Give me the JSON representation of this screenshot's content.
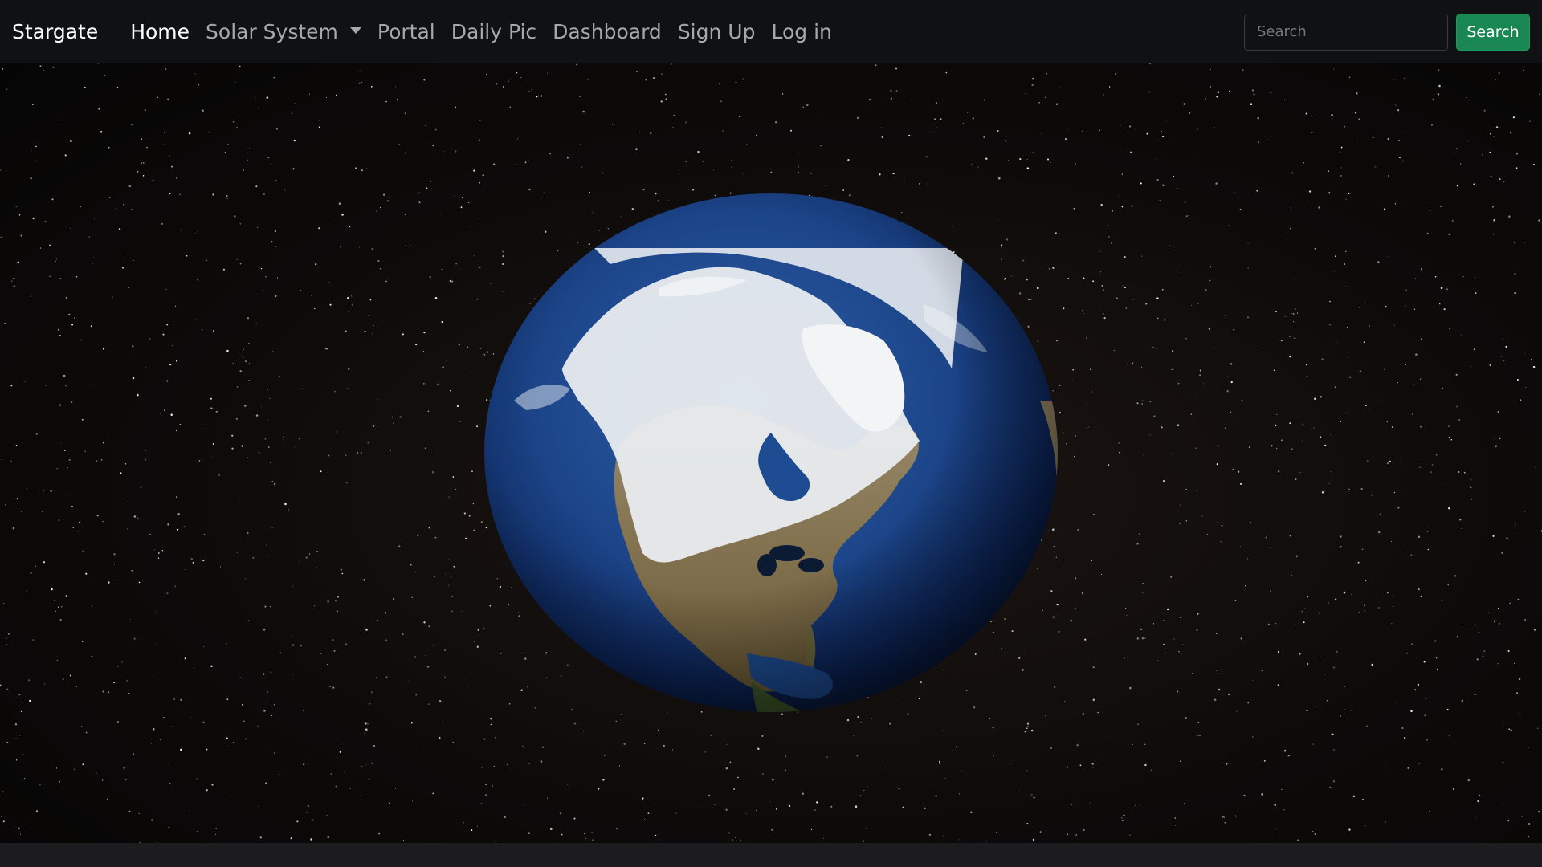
{
  "navbar": {
    "brand": "Stargate",
    "links": [
      {
        "label": "Home",
        "active": true
      },
      {
        "label": "Solar System",
        "dropdown": true
      },
      {
        "label": "Portal"
      },
      {
        "label": "Daily Pic"
      },
      {
        "label": "Dashboard"
      },
      {
        "label": "Sign Up"
      },
      {
        "label": "Log in"
      }
    ],
    "search": {
      "placeholder": "Search",
      "value": "",
      "button_label": "Search"
    }
  },
  "scene": {
    "subject": "earth-globe",
    "icons": {
      "dropdown": "caret-down-icon"
    }
  },
  "colors": {
    "navbar_bg": "#101112",
    "accent": "#198754",
    "active_link": "#ffffff",
    "inactive_link": "#a8a8a8",
    "space_bg": "#0d0b0a"
  }
}
